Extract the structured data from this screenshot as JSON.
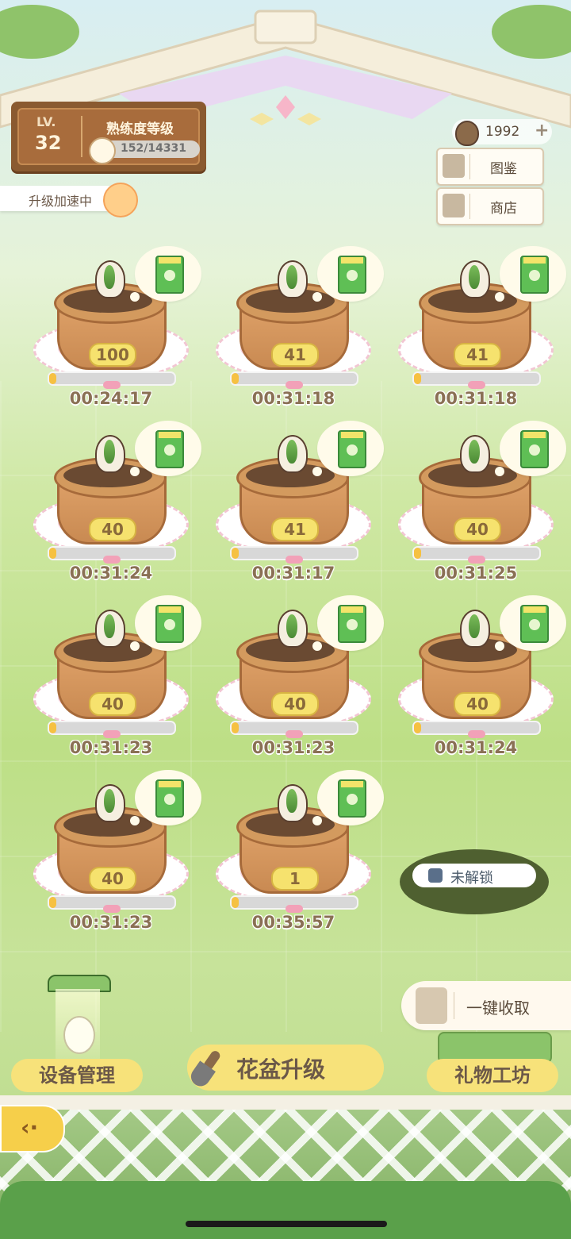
{
  "level": {
    "label": "LV.",
    "value": "32"
  },
  "mastery": {
    "title": "熟练度等级",
    "progress_text": "152/14331",
    "progress": 0.0106
  },
  "speedup": {
    "label": "升级加速中"
  },
  "currency": {
    "value": "1992",
    "plus": "+"
  },
  "side_buttons": {
    "collection_label": "图鉴",
    "shop_label": "商店"
  },
  "pots": [
    {
      "level": "100",
      "timer": "00:24:17",
      "progress": 0.06
    },
    {
      "level": "41",
      "timer": "00:31:18",
      "progress": 0.06
    },
    {
      "level": "41",
      "timer": "00:31:18",
      "progress": 0.06
    },
    {
      "level": "40",
      "timer": "00:31:24",
      "progress": 0.06
    },
    {
      "level": "41",
      "timer": "00:31:17",
      "progress": 0.06
    },
    {
      "level": "40",
      "timer": "00:31:25",
      "progress": 0.06
    },
    {
      "level": "40",
      "timer": "00:31:23",
      "progress": 0.06
    },
    {
      "level": "40",
      "timer": "00:31:23",
      "progress": 0.06
    },
    {
      "level": "40",
      "timer": "00:31:24",
      "progress": 0.06
    },
    {
      "level": "40",
      "timer": "00:31:23",
      "progress": 0.06
    },
    {
      "level": "1",
      "timer": "00:35:57",
      "progress": 0.06
    }
  ],
  "locked_slot": {
    "label": "未解锁"
  },
  "harvest": {
    "label": "一键收取"
  },
  "bottom": {
    "device_label": "设备管理",
    "upgrade_label": "花盆升级",
    "gift_label": "礼物工坊",
    "back_icon": "back-arrow-icon"
  },
  "colors": {
    "accent_yellow": "#f7e27a",
    "progress_fill": "#f6c142"
  }
}
